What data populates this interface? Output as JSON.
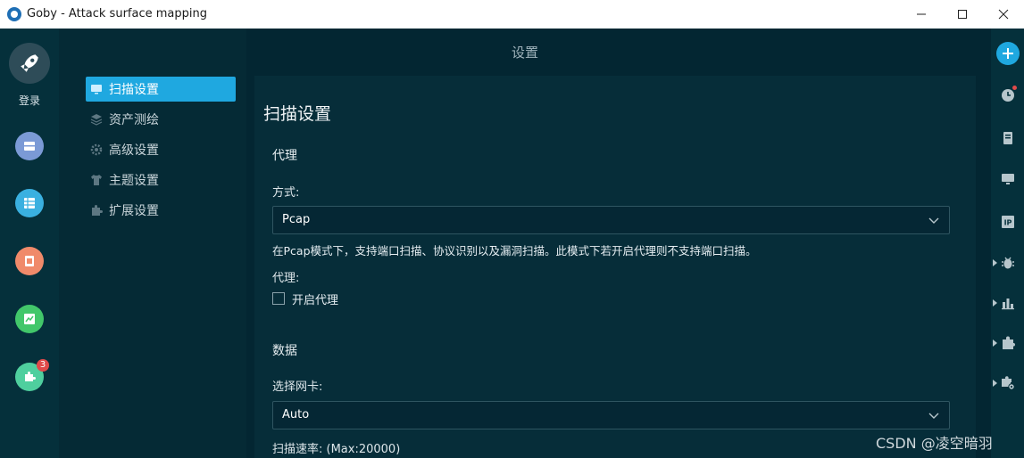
{
  "window": {
    "title": "Goby - Attack surface mapping"
  },
  "leftrail": {
    "login_label": "登录",
    "badge_count": "3"
  },
  "page": {
    "title": "设置"
  },
  "settings_nav": {
    "items": [
      {
        "label": "扫描设置",
        "icon": "monitor-icon",
        "active": true
      },
      {
        "label": "资产测绘",
        "icon": "layers-icon"
      },
      {
        "label": "高级设置",
        "icon": "gear-icon"
      },
      {
        "label": "主题设置",
        "icon": "shirt-icon"
      },
      {
        "label": "扩展设置",
        "icon": "puzzle-icon"
      }
    ]
  },
  "panel": {
    "title": "扫描设置",
    "proxy_section": "代理",
    "mode_label": "方式:",
    "mode_value": "Pcap",
    "mode_note": "在Pcap模式下，支持端口扫描、协议识别以及漏洞扫描。此模式下若开启代理则不支持端口扫描。",
    "proxy_label": "代理:",
    "proxy_checkbox_label": "开启代理",
    "data_section": "数据",
    "nic_label": "选择网卡:",
    "nic_value": "Auto",
    "rate_label": "扫描速率: (Max:20000)"
  },
  "watermark": "CSDN @凌空暗羽",
  "colors": {
    "accent": "#1fa8e0",
    "background": "#032632",
    "panel": "#062d39"
  }
}
